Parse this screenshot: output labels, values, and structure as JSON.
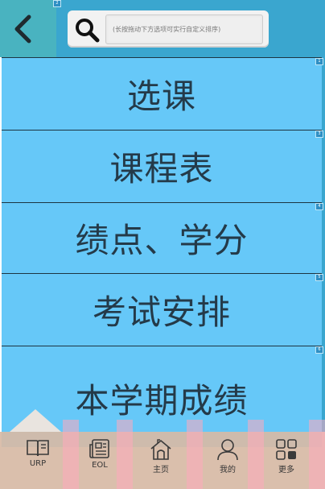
{
  "header": {
    "back_icon": "chevron-left-icon",
    "search_icon": "magnifier-icon",
    "search_placeholder": "(长按拖动下方选项可实行自定义排序)",
    "header_tag": "2"
  },
  "menu": {
    "items": [
      {
        "label": "选课",
        "tag": "1"
      },
      {
        "label": "课程表",
        "tag": "3"
      },
      {
        "label": "绩点、学分",
        "tag": "4"
      },
      {
        "label": "考试安排",
        "tag": "5"
      },
      {
        "label": "本学期成绩",
        "tag": "6"
      }
    ]
  },
  "tabbar": {
    "items": [
      {
        "label": "URP",
        "icon": "book-icon"
      },
      {
        "label": "EOL",
        "icon": "newspaper-icon"
      },
      {
        "label": "主页",
        "icon": "home-icon"
      },
      {
        "label": "我的",
        "icon": "person-icon"
      },
      {
        "label": "更多",
        "icon": "grid-icon"
      }
    ]
  },
  "colors": {
    "header": "#3aa6cf",
    "menu_bg": "#66c8f8",
    "menu_text": "#243a49",
    "tabbar": "#d7baa5"
  }
}
